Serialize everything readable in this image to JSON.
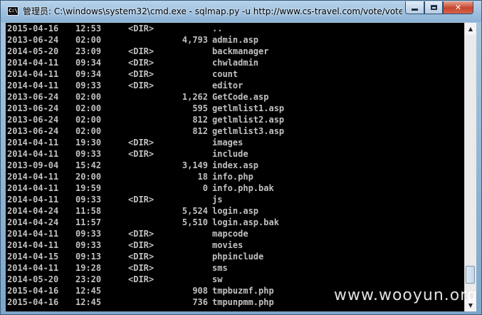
{
  "window": {
    "icon_text": "C:\\",
    "title": "管理员: C:\\windows\\system32\\cmd.exe - sqlmap.py  -u http://www.cs-travel.com/vote/vote..."
  },
  "controls": {
    "minimize": "minimize",
    "maximize": "maximize",
    "close": "✕"
  },
  "listing": [
    {
      "date": "2015-04-16",
      "time": "12:53",
      "dir": "<DIR>",
      "size": "",
      "name": ".."
    },
    {
      "date": "2013-06-24",
      "time": "02:00",
      "dir": "",
      "size": "4,793",
      "name": "admin.asp"
    },
    {
      "date": "2014-05-20",
      "time": "23:09",
      "dir": "<DIR>",
      "size": "",
      "name": "backmanager"
    },
    {
      "date": "2014-04-11",
      "time": "09:34",
      "dir": "<DIR>",
      "size": "",
      "name": "chwladmin"
    },
    {
      "date": "2014-04-11",
      "time": "09:34",
      "dir": "<DIR>",
      "size": "",
      "name": "count"
    },
    {
      "date": "2014-04-11",
      "time": "09:33",
      "dir": "<DIR>",
      "size": "",
      "name": "editor"
    },
    {
      "date": "2013-06-24",
      "time": "02:00",
      "dir": "",
      "size": "1,262",
      "name": "GetCode.asp"
    },
    {
      "date": "2013-06-24",
      "time": "02:00",
      "dir": "",
      "size": "595",
      "name": "getlmlist1.asp"
    },
    {
      "date": "2013-06-24",
      "time": "02:00",
      "dir": "",
      "size": "812",
      "name": "getlmlist2.asp"
    },
    {
      "date": "2013-06-24",
      "time": "02:00",
      "dir": "",
      "size": "812",
      "name": "getlmlist3.asp"
    },
    {
      "date": "2014-04-11",
      "time": "19:30",
      "dir": "<DIR>",
      "size": "",
      "name": "images"
    },
    {
      "date": "2014-04-11",
      "time": "09:33",
      "dir": "<DIR>",
      "size": "",
      "name": "include"
    },
    {
      "date": "2013-09-04",
      "time": "15:42",
      "dir": "",
      "size": "3,149",
      "name": "index.asp"
    },
    {
      "date": "2014-04-11",
      "time": "20:00",
      "dir": "",
      "size": "18",
      "name": "info.php"
    },
    {
      "date": "2014-04-11",
      "time": "19:59",
      "dir": "",
      "size": "0",
      "name": "info.php.bak"
    },
    {
      "date": "2014-04-11",
      "time": "09:33",
      "dir": "<DIR>",
      "size": "",
      "name": "js"
    },
    {
      "date": "2014-04-24",
      "time": "11:58",
      "dir": "",
      "size": "5,524",
      "name": "login.asp"
    },
    {
      "date": "2014-04-24",
      "time": "11:57",
      "dir": "",
      "size": "5,510",
      "name": "login.asp.bak"
    },
    {
      "date": "2014-04-11",
      "time": "09:33",
      "dir": "<DIR>",
      "size": "",
      "name": "mapcode"
    },
    {
      "date": "2014-04-11",
      "time": "09:33",
      "dir": "<DIR>",
      "size": "",
      "name": "movies"
    },
    {
      "date": "2014-04-15",
      "time": "09:13",
      "dir": "<DIR>",
      "size": "",
      "name": "phpinclude"
    },
    {
      "date": "2014-04-11",
      "time": "19:28",
      "dir": "<DIR>",
      "size": "",
      "name": "sms"
    },
    {
      "date": "2014-05-20",
      "time": "23:20",
      "dir": "<DIR>",
      "size": "",
      "name": "sw"
    },
    {
      "date": "2015-04-16",
      "time": "12:45",
      "dir": "",
      "size": "908",
      "name": "tmpbuzmf.php"
    },
    {
      "date": "2015-04-16",
      "time": "12:45",
      "dir": "",
      "size": "736",
      "name": "tmpunpmm.php"
    }
  ],
  "scrollbar": {
    "up_arrow": "▲",
    "down_arrow": "▼",
    "position": 0.89
  },
  "watermark": "www.wooyun.org"
}
